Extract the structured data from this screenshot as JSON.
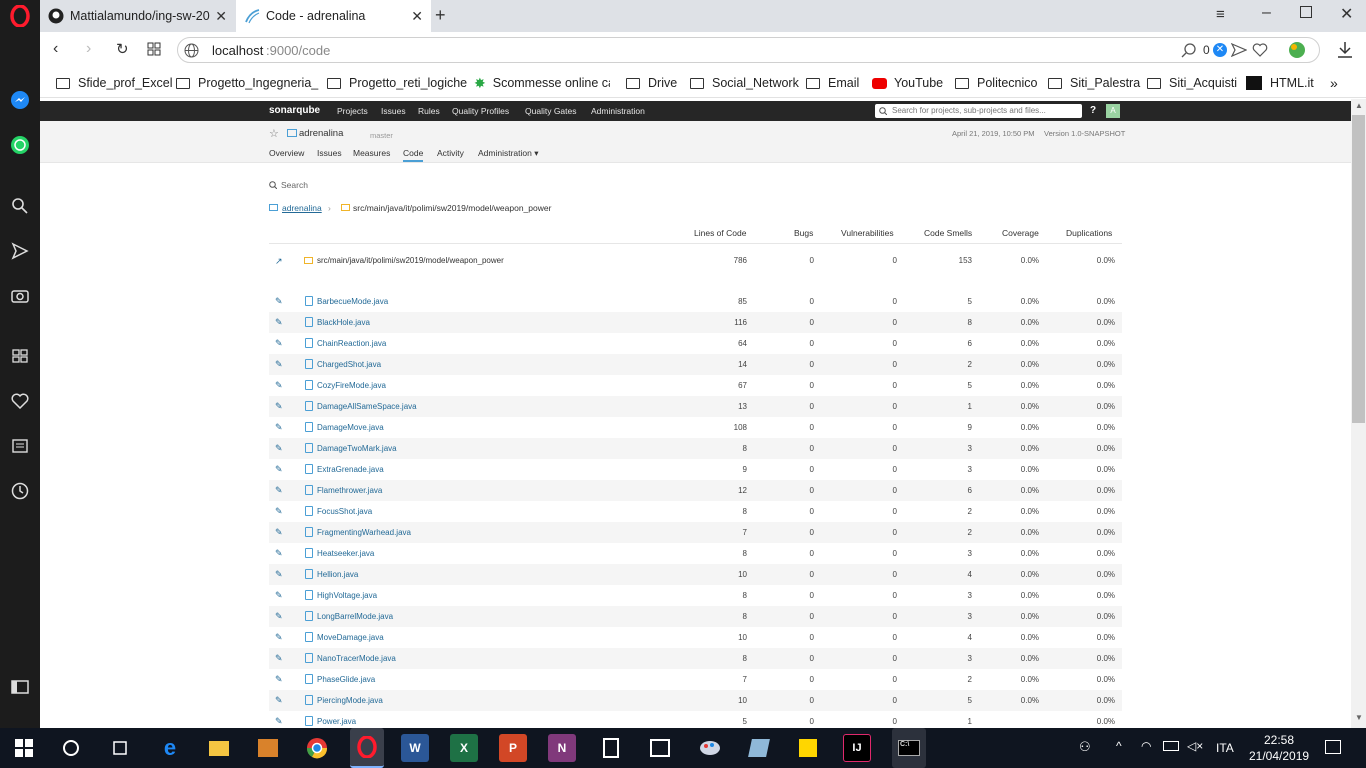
{
  "browser": {
    "tabs": [
      {
        "label": "Mattialamundo/ing-sw-20"
      },
      {
        "label": "Code - adrenalina"
      }
    ],
    "address": {
      "host": "localhost",
      "path": ":9000/code"
    },
    "address_badge": "0",
    "bookmarks": [
      {
        "label": "Sfide_prof_Excel",
        "icon": "folder-icon"
      },
      {
        "label": "Progetto_Ingegneria_",
        "icon": "folder-icon"
      },
      {
        "label": "Progetto_reti_logiche",
        "icon": "folder-icon"
      },
      {
        "label": "Scommesse online ca",
        "icon": "scommesse-icon"
      },
      {
        "label": "Drive",
        "icon": "folder-icon"
      },
      {
        "label": "Social_Network",
        "icon": "folder-icon"
      },
      {
        "label": "Email",
        "icon": "folder-icon"
      },
      {
        "label": "YouTube",
        "icon": "youtube-icon"
      },
      {
        "label": "Politecnico",
        "icon": "folder-icon"
      },
      {
        "label": "Siti_Palestra",
        "icon": "folder-icon"
      },
      {
        "label": "Siti_Acquisti",
        "icon": "folder-icon"
      },
      {
        "label": "HTML.it",
        "icon": "htmlit-icon"
      }
    ],
    "more": "»"
  },
  "sonar": {
    "logo": "sonarqube",
    "nav": [
      "Projects",
      "Issues",
      "Rules",
      "Quality Profiles",
      "Quality Gates",
      "Administration"
    ],
    "search_placeholder": "Search for projects, sub-projects and files...",
    "help": "?",
    "avatar": "A",
    "project": "adrenalina",
    "branch": "master",
    "analysis": "April 21, 2019, 10:50 PM",
    "version": "Version 1.0-SNAPSHOT",
    "tabs": [
      "Overview",
      "Issues",
      "Measures",
      "Code",
      "Activity",
      "Administration ▾"
    ],
    "active_tab": "Code",
    "search_label": "Search",
    "breadcrumb": {
      "project": "adrenalina",
      "sep": "›",
      "path": "src/main/java/it/polimi/sw2019/model/weapon_power"
    },
    "columns": [
      "Lines of Code",
      "Bugs",
      "Vulnerabilities",
      "Code Smells",
      "Coverage",
      "Duplications"
    ],
    "summary": {
      "name": "src/main/java/it/polimi/sw2019/model/weapon_power",
      "loc": "786",
      "bugs": "0",
      "vulns": "0",
      "smells": "153",
      "coverage": "0.0%",
      "dup": "0.0%"
    },
    "files": [
      {
        "name": "BarbecueMode.java",
        "loc": "85",
        "bugs": "0",
        "vulns": "0",
        "smells": "5",
        "coverage": "0.0%",
        "dup": "0.0%"
      },
      {
        "name": "BlackHole.java",
        "loc": "116",
        "bugs": "0",
        "vulns": "0",
        "smells": "8",
        "coverage": "0.0%",
        "dup": "0.0%"
      },
      {
        "name": "ChainReaction.java",
        "loc": "64",
        "bugs": "0",
        "vulns": "0",
        "smells": "6",
        "coverage": "0.0%",
        "dup": "0.0%"
      },
      {
        "name": "ChargedShot.java",
        "loc": "14",
        "bugs": "0",
        "vulns": "0",
        "smells": "2",
        "coverage": "0.0%",
        "dup": "0.0%"
      },
      {
        "name": "CozyFireMode.java",
        "loc": "67",
        "bugs": "0",
        "vulns": "0",
        "smells": "5",
        "coverage": "0.0%",
        "dup": "0.0%"
      },
      {
        "name": "DamageAllSameSpace.java",
        "loc": "13",
        "bugs": "0",
        "vulns": "0",
        "smells": "1",
        "coverage": "0.0%",
        "dup": "0.0%"
      },
      {
        "name": "DamageMove.java",
        "loc": "108",
        "bugs": "0",
        "vulns": "0",
        "smells": "9",
        "coverage": "0.0%",
        "dup": "0.0%"
      },
      {
        "name": "DamageTwoMark.java",
        "loc": "8",
        "bugs": "0",
        "vulns": "0",
        "smells": "3",
        "coverage": "0.0%",
        "dup": "0.0%"
      },
      {
        "name": "ExtraGrenade.java",
        "loc": "9",
        "bugs": "0",
        "vulns": "0",
        "smells": "3",
        "coverage": "0.0%",
        "dup": "0.0%"
      },
      {
        "name": "Flamethrower.java",
        "loc": "12",
        "bugs": "0",
        "vulns": "0",
        "smells": "6",
        "coverage": "0.0%",
        "dup": "0.0%"
      },
      {
        "name": "FocusShot.java",
        "loc": "8",
        "bugs": "0",
        "vulns": "0",
        "smells": "2",
        "coverage": "0.0%",
        "dup": "0.0%"
      },
      {
        "name": "FragmentingWarhead.java",
        "loc": "7",
        "bugs": "0",
        "vulns": "0",
        "smells": "2",
        "coverage": "0.0%",
        "dup": "0.0%"
      },
      {
        "name": "Heatseeker.java",
        "loc": "8",
        "bugs": "0",
        "vulns": "0",
        "smells": "3",
        "coverage": "0.0%",
        "dup": "0.0%"
      },
      {
        "name": "Hellion.java",
        "loc": "10",
        "bugs": "0",
        "vulns": "0",
        "smells": "4",
        "coverage": "0.0%",
        "dup": "0.0%"
      },
      {
        "name": "HighVoltage.java",
        "loc": "8",
        "bugs": "0",
        "vulns": "0",
        "smells": "3",
        "coverage": "0.0%",
        "dup": "0.0%"
      },
      {
        "name": "LongBarrelMode.java",
        "loc": "8",
        "bugs": "0",
        "vulns": "0",
        "smells": "3",
        "coverage": "0.0%",
        "dup": "0.0%"
      },
      {
        "name": "MoveDamage.java",
        "loc": "10",
        "bugs": "0",
        "vulns": "0",
        "smells": "4",
        "coverage": "0.0%",
        "dup": "0.0%"
      },
      {
        "name": "NanoTracerMode.java",
        "loc": "8",
        "bugs": "0",
        "vulns": "0",
        "smells": "3",
        "coverage": "0.0%",
        "dup": "0.0%"
      },
      {
        "name": "PhaseGlide.java",
        "loc": "7",
        "bugs": "0",
        "vulns": "0",
        "smells": "2",
        "coverage": "0.0%",
        "dup": "0.0%"
      },
      {
        "name": "PiercingMode.java",
        "loc": "10",
        "bugs": "0",
        "vulns": "0",
        "smells": "5",
        "coverage": "0.0%",
        "dup": "0.0%"
      },
      {
        "name": "Power.java",
        "loc": "5",
        "bugs": "0",
        "vulns": "0",
        "smells": "1",
        "coverage": "",
        "dup": "0.0%"
      }
    ]
  },
  "taskbar": {
    "lang": "ITA",
    "time": "22:58",
    "date": "21/04/2019"
  },
  "colors": {
    "accent": "#236a97",
    "sonar_nav": "#262626",
    "taskbar": "#0f1520",
    "opera_red": "#ff1b2d"
  }
}
